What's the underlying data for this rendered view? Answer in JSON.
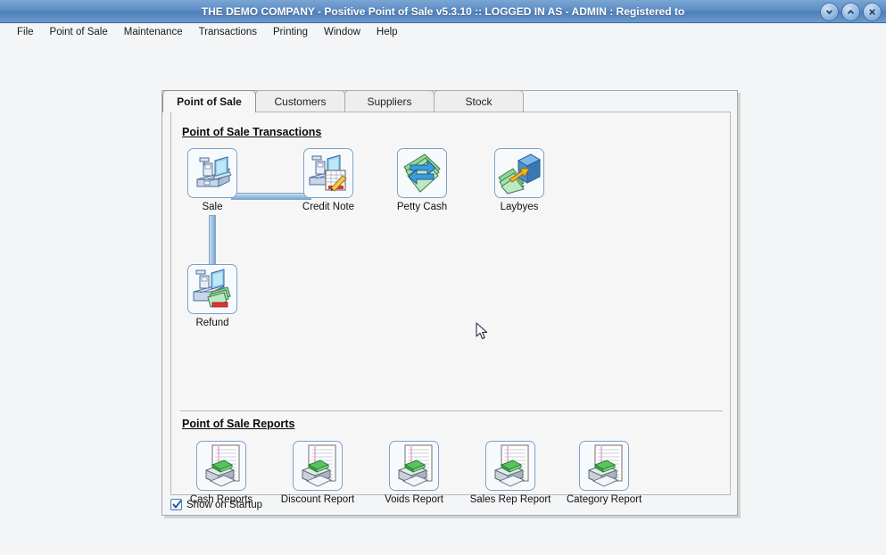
{
  "window": {
    "title": "THE DEMO COMPANY - Positive Point of Sale v5.3.10 :: LOGGED IN AS - ADMIN : Registered to",
    "controls": [
      {
        "name": "minimize-button",
        "icon": "chevron-down-icon"
      },
      {
        "name": "restore-button",
        "icon": "chevron-up-icon"
      },
      {
        "name": "close-button",
        "icon": "close-icon"
      }
    ]
  },
  "menubar": {
    "items": [
      {
        "label": "File"
      },
      {
        "label": "Point of Sale"
      },
      {
        "label": "Maintenance"
      },
      {
        "label": "Transactions"
      },
      {
        "label": "Printing"
      },
      {
        "label": "Window"
      },
      {
        "label": "Help"
      }
    ]
  },
  "tabs": [
    {
      "label": "Point of Sale",
      "active": true
    },
    {
      "label": "Customers",
      "active": false
    },
    {
      "label": "Suppliers",
      "active": false
    },
    {
      "label": "Stock",
      "active": false
    }
  ],
  "sections": {
    "transactions": {
      "title": "Point of Sale Transactions",
      "items": [
        {
          "label": "Sale",
          "icon": "cash-register-icon"
        },
        {
          "label": "Credit Note",
          "icon": "cash-register-document-icon"
        },
        {
          "label": "Petty Cash",
          "icon": "banknotes-exchange-icon"
        },
        {
          "label": "Laybyes",
          "icon": "banknotes-box-icon"
        },
        {
          "label": "Refund",
          "icon": "cash-register-money-icon"
        }
      ]
    },
    "reports": {
      "title": "Point of Sale Reports",
      "items": [
        {
          "label": "Cash Reports",
          "icon": "printer-report-icon"
        },
        {
          "label": "Discount Report",
          "icon": "printer-report-icon"
        },
        {
          "label": "Voids Report",
          "icon": "printer-report-icon"
        },
        {
          "label": "Sales Rep Report",
          "icon": "printer-report-icon"
        },
        {
          "label": "Category Report",
          "icon": "printer-report-icon"
        }
      ]
    }
  },
  "footer": {
    "show_on_startup_label": "Show on Startup",
    "show_on_startup_checked": true
  },
  "colors": {
    "titlebar_blue": "#5e8dc4",
    "accent_border": "#7b9fc4",
    "page_background": "#f4f5f7",
    "panel_background": "#f6f6f6",
    "connector_blue": "#9fc0e0"
  }
}
